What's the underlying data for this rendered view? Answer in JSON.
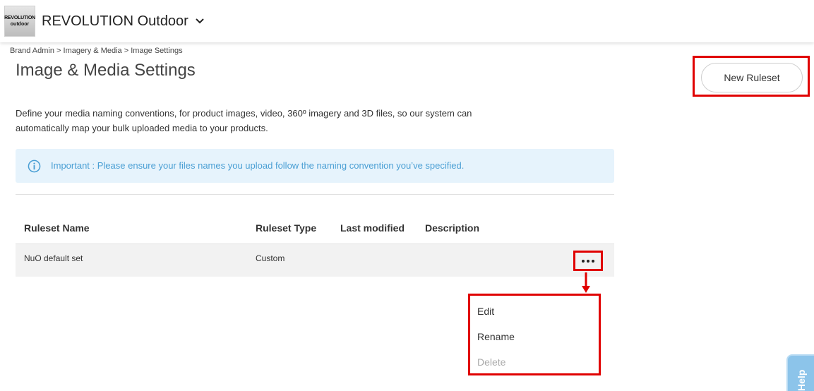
{
  "header": {
    "logo_line1": "REVOLUTION",
    "logo_line2": "outdoor",
    "brand_name": "REVOLUTION Outdoor",
    "brand_menu_icon": "chevron-down-icon"
  },
  "breadcrumb": "Brand Admin > Imagery & Media > Image Settings",
  "page": {
    "title": "Image & Media Settings",
    "new_ruleset_label": "New Ruleset",
    "description": "Define your media naming conventions, for product images, video, 360º imagery and 3D files, so our system can automatically map your bulk uploaded media to your products.",
    "info_icon": "info-circle-icon",
    "info_text": "Important : Please ensure your files names you upload follow the naming convention you’ve specified."
  },
  "table": {
    "columns": [
      "Ruleset Name",
      "Ruleset Type",
      "Last modified",
      "Description"
    ],
    "rows": [
      {
        "name": "NuO default set",
        "type": "Custom",
        "modified": "",
        "description": ""
      }
    ]
  },
  "row_menu": {
    "items": [
      "Edit",
      "Rename",
      "Delete"
    ]
  },
  "help_label": "Help",
  "colors": {
    "highlight": "#e00000",
    "info_bg": "#e6f3fc",
    "info_text": "#4a9fd4",
    "help_tab": "#8cc4ea"
  }
}
